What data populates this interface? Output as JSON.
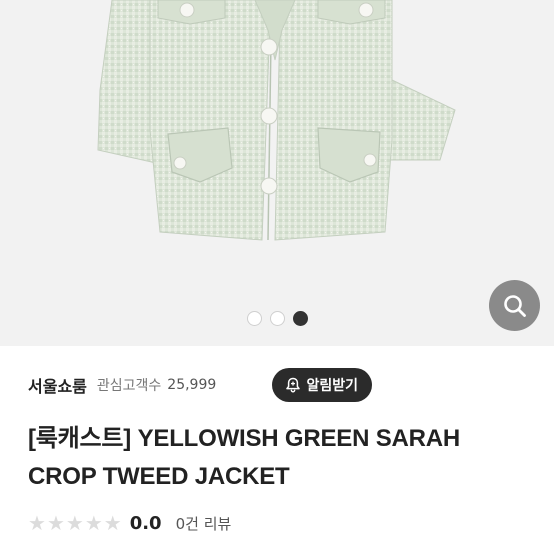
{
  "carousel": {
    "image_alt": "Yellowish green tweed cropped jacket",
    "dots": [
      {
        "active": false
      },
      {
        "active": false
      },
      {
        "active": true
      }
    ],
    "zoom_icon": "search-icon"
  },
  "seller": {
    "name": "서울쇼룸",
    "follower_label": "관심고객수",
    "follower_count": "25,999",
    "alarm_button": {
      "icon": "bell-plus-icon",
      "label": "알림받기"
    }
  },
  "product": {
    "title_line1": "[룩캐스트] YELLOWISH GREEN SARAH",
    "title_line2": "CROP TWEED JACKET"
  },
  "rating": {
    "stars": 0,
    "max_stars": 5,
    "value": "0.0",
    "review_count": "0건 리뷰"
  },
  "colors": {
    "tweed": "#dde6d8",
    "dark_button": "#2b2b2b",
    "zoom_button": "#8a8a8a",
    "star_empty": "#dcdcdc"
  }
}
